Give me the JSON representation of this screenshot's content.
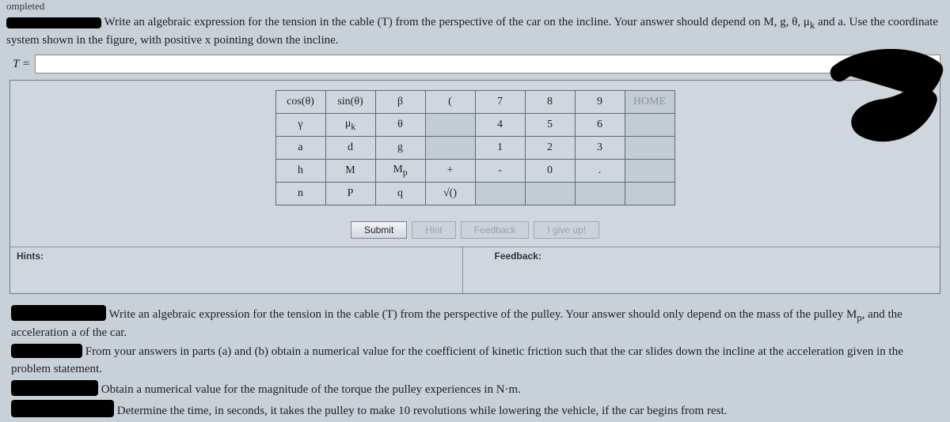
{
  "top_partial": "ompleted",
  "prompt_main": "Write an algebraic expression for the tension in the cable (T) from the perspective of the car on the incline. Your answer should depend on M, g, θ, μ",
  "prompt_sub": "k",
  "prompt_tail": " and a. Use the coordinate system shown in the figure, with positive x pointing down the incline.",
  "answer_label": "T =",
  "answer_value": "",
  "keypad": {
    "rows": [
      [
        "cos(θ)",
        "sin(θ)",
        "β",
        "(",
        "7",
        "8",
        "9",
        "HOME"
      ],
      [
        "γ",
        "μk",
        "θ",
        "",
        "4",
        "5",
        "6",
        ""
      ],
      [
        "a",
        "d",
        "g",
        "",
        "1",
        "2",
        "3",
        ""
      ],
      [
        "h",
        "M",
        "Mp",
        "+",
        "-",
        "0",
        ".",
        ""
      ],
      [
        "n",
        "P",
        "q",
        "√()",
        "",
        "",
        "",
        ""
      ]
    ],
    "faded_cells": [
      "0,7",
      "1,3",
      "1,7",
      "2,3",
      "2,7",
      "3,7",
      "4,4",
      "4,5",
      "4,6",
      "4,7"
    ]
  },
  "buttons": {
    "submit": "Submit",
    "hint": "Hint",
    "feedback": "Feedback",
    "giveup": "I give up!"
  },
  "panels": {
    "hints": "Hints:",
    "feedback": "Feedback:"
  },
  "followups": {
    "q_b_1": "Write an algebraic expression for the tension in the cable (T) from the perspective of the pulley. Your answer should only depend on the mass of the pulley M",
    "q_b_sub": "p",
    "q_b_2": ", and the acceleration a of the car.",
    "q_c": "From your answers in parts (a) and (b) obtain a numerical value for the coefficient of kinetic friction such that the car slides down the incline at the acceleration given in the problem statement.",
    "q_d": "Obtain a numerical value for the magnitude of the torque the pulley experiences in N·m.",
    "q_e": "Determine the time, in seconds, it takes the pulley to make 10 revolutions while lowering the vehicle, if the car begins from rest."
  }
}
